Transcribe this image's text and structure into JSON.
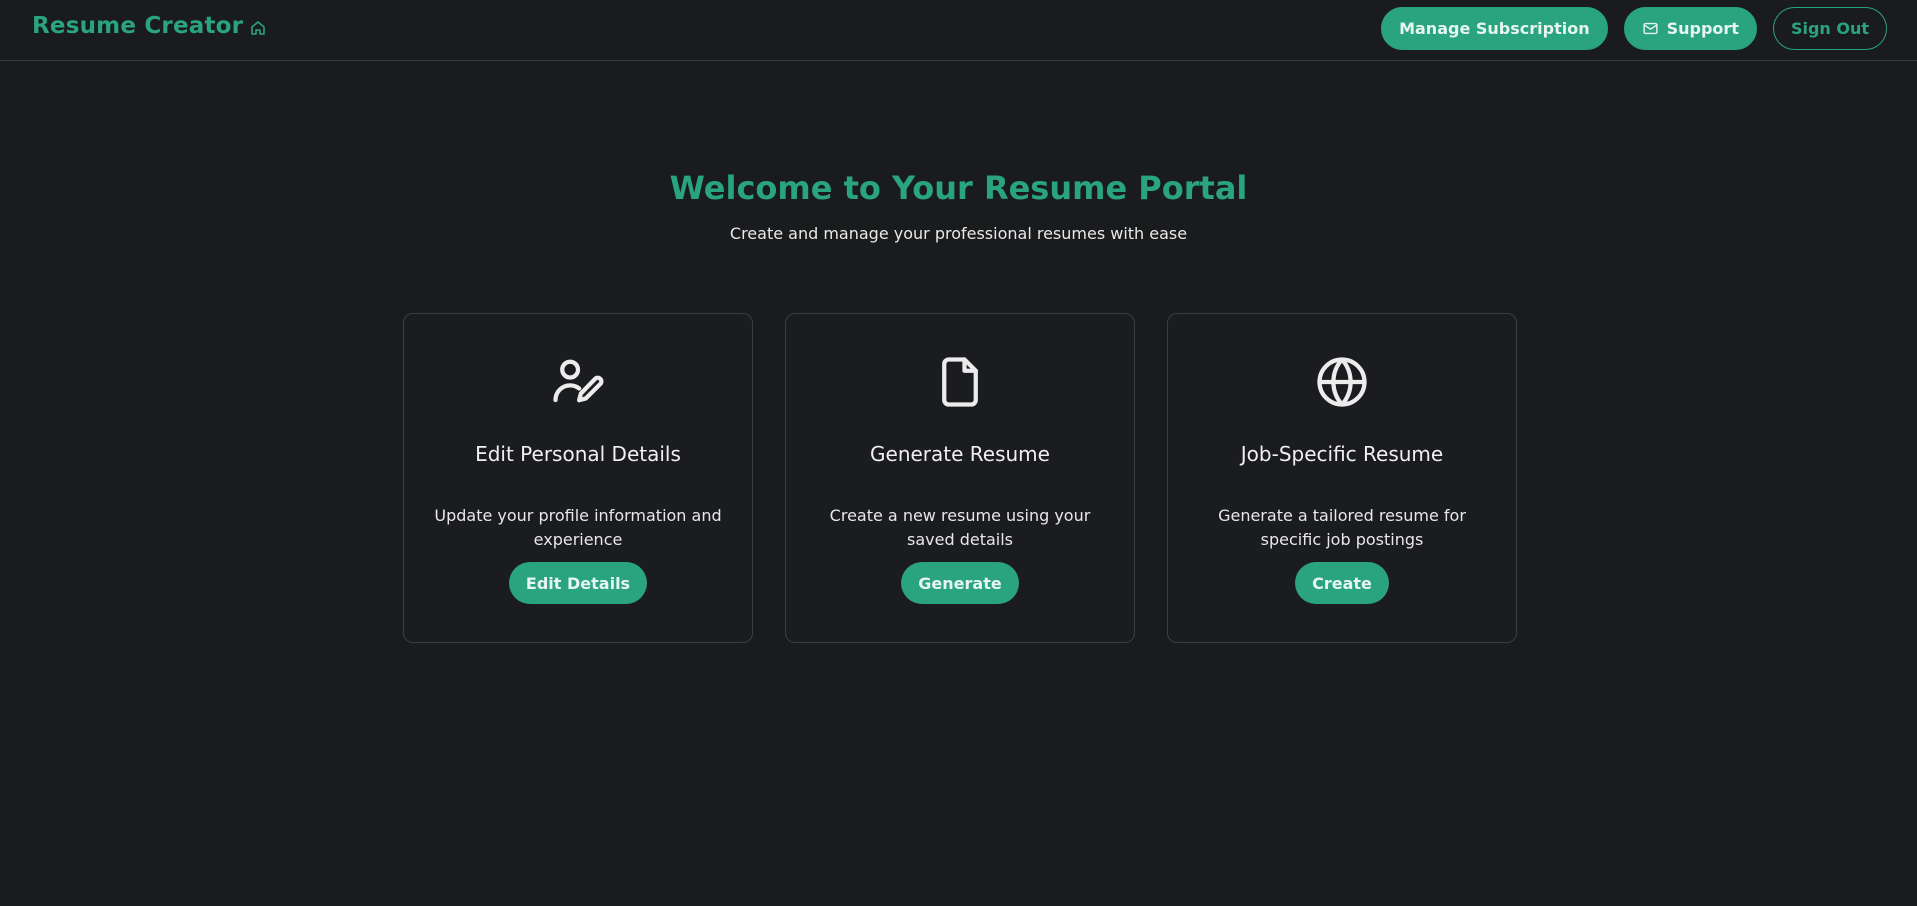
{
  "header": {
    "brand": "Resume Creator",
    "home_icon": "home-icon",
    "manage_subscription_label": "Manage Subscription",
    "support_label": "Support",
    "support_icon": "mail-icon",
    "sign_out_label": "Sign Out"
  },
  "hero": {
    "title": "Welcome to Your Resume Portal",
    "subtitle": "Create and manage your professional resumes with ease"
  },
  "cards": [
    {
      "icon": "user-edit-icon",
      "title": "Edit Personal Details",
      "description": "Update your profile information and experience",
      "button": "Edit Details"
    },
    {
      "icon": "file-icon",
      "title": "Generate Resume",
      "description": "Create a new resume using your saved details",
      "button": "Generate"
    },
    {
      "icon": "globe-icon",
      "title": "Job-Specific Resume",
      "description": "Generate a tailored resume for specific job postings",
      "button": "Create"
    }
  ],
  "colors": {
    "background": "#1a1b1d",
    "accent": "#2aa37f",
    "border": "#3b3d40",
    "text": "#e8e8e8"
  }
}
